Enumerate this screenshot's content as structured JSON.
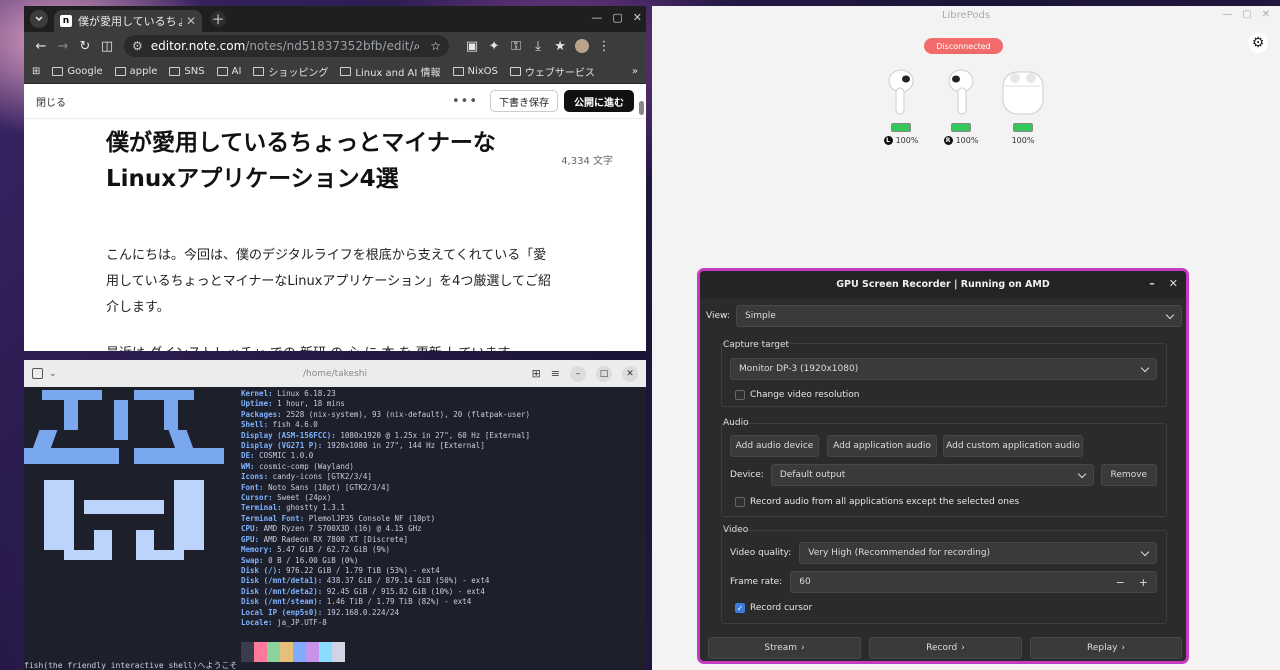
{
  "chrome": {
    "tab_title": "僕が愛用しているちょっとマ",
    "favicon_letter": "n",
    "url_host": "editor.note.com",
    "url_path": "/notes/nd51837352bfb/edit/",
    "bookmarks": [
      "Google",
      "apple",
      "SNS",
      "AI",
      "ショッピング",
      "Linux and AI 情報",
      "NixOS",
      "ウェブサービス"
    ],
    "more": "»"
  },
  "note": {
    "close_label": "閉じる",
    "more_label": "•••",
    "draft_label": "下書き保存",
    "publish_label": "公開に進む",
    "title": "僕が愛用しているちょっとマイナーなLinuxアプリケーション4選",
    "char_count": "4,334 文字",
    "paragraph": "こんにちは。今回は、僕のデジタルライフを根底から支えてくれている「愛用しているちょっとマイナーなLinuxアプリケーション」を4つ厳選してご紹介します。",
    "paragraph2": "最近は ダインストレッチャ での 新研 の 心 に 本 を 更新 しています。"
  },
  "terminal": {
    "title": "/home/takeshi",
    "lines": [
      {
        "k": "Kernel",
        "v": "Linux 6.18.23"
      },
      {
        "k": "Uptime",
        "v": "1 hour, 18 mins"
      },
      {
        "k": "Packages",
        "v": "2528 (nix-system), 93 (nix-default), 20 (flatpak-user)"
      },
      {
        "k": "Shell",
        "v": "fish 4.6.0"
      },
      {
        "k": "Display (ASM-156FCC)",
        "v": "1080x1920 @ 1.25x in 27\", 60 Hz [External]"
      },
      {
        "k": "Display (VG271 P)",
        "v": "1920x1080 in 27\", 144 Hz [External]"
      },
      {
        "k": "DE",
        "v": "COSMIC 1.0.0"
      },
      {
        "k": "WM",
        "v": "cosmic-comp (Wayland)"
      },
      {
        "k": "Icons",
        "v": "candy-icons [GTK2/3/4]"
      },
      {
        "k": "Font",
        "v": "Noto Sans (10pt) [GTK2/3/4]"
      },
      {
        "k": "Cursor",
        "v": "Sweet (24px)"
      },
      {
        "k": "Terminal",
        "v": "ghostty 1.3.1"
      },
      {
        "k": "Terminal Font",
        "v": "PlemolJP35 Console NF (10pt)"
      },
      {
        "k": "CPU",
        "v": "AMD Ryzen 7 5700X3D (16) @ 4.15 GHz"
      },
      {
        "k": "GPU",
        "v": "AMD Radeon RX 7800 XT [Discrete]"
      },
      {
        "k": "Memory",
        "v": "5.47 GiB / 62.72 GiB (9%)"
      },
      {
        "k": "Swap",
        "v": "0 B / 16.00 GiB (0%)"
      },
      {
        "k": "Disk (/)",
        "v": "976.22 GiB / 1.79 TiB (53%) - ext4"
      },
      {
        "k": "Disk (/mnt/deta1)",
        "v": "438.37 GiB / 879.14 GiB (50%) - ext4"
      },
      {
        "k": "Disk (/mnt/deta2)",
        "v": "92.45 GiB / 915.82 GiB (10%) - ext4"
      },
      {
        "k": "Disk (/mnt/steam)",
        "v": "1.46 TiB / 1.79 TiB (82%) - ext4"
      },
      {
        "k": "Local IP (enp5s0)",
        "v": "192.168.0.224/24"
      },
      {
        "k": "Locale",
        "v": "ja_JP.UTF-8"
      }
    ],
    "palette": [
      "#3a3c4e",
      "#ff7a9a",
      "#8bd49c",
      "#e6c07b",
      "#82aaff",
      "#c792ea",
      "#89ddff",
      "#d0d4e4"
    ],
    "greeting": "fish(the friendly interactive shell)へようこそ"
  },
  "librepods": {
    "title": "LibrePods",
    "status": "Disconnected",
    "pods": [
      {
        "badge": "L",
        "battery": "100%",
        "level": 1.0
      },
      {
        "badge": "R",
        "battery": "100%",
        "level": 1.0
      },
      {
        "badge": "",
        "battery": "100%",
        "level": 1.0
      }
    ]
  },
  "gsr": {
    "title": "GPU Screen Recorder | Running on AMD",
    "view_label": "View:",
    "view_value": "Simple",
    "capture_label": "Capture target",
    "capture_value": "Monitor DP-3 (1920x1080)",
    "change_res_label": "Change video resolution",
    "audio_label": "Audio",
    "add_audio_device": "Add audio device",
    "add_app_audio": "Add application audio",
    "add_custom_app_audio": "Add custom application audio",
    "device_label": "Device:",
    "device_value": "Default output",
    "remove_label": "Remove",
    "record_all_label": "Record audio from all applications except the selected ones",
    "video_label": "Video",
    "quality_label": "Video quality:",
    "quality_value": "Very High (Recommended for recording)",
    "framerate_label": "Frame rate:",
    "framerate_value": "60",
    "record_cursor_label": "Record cursor",
    "stream_label": "Stream",
    "record_label": "Record",
    "replay_label": "Replay"
  }
}
